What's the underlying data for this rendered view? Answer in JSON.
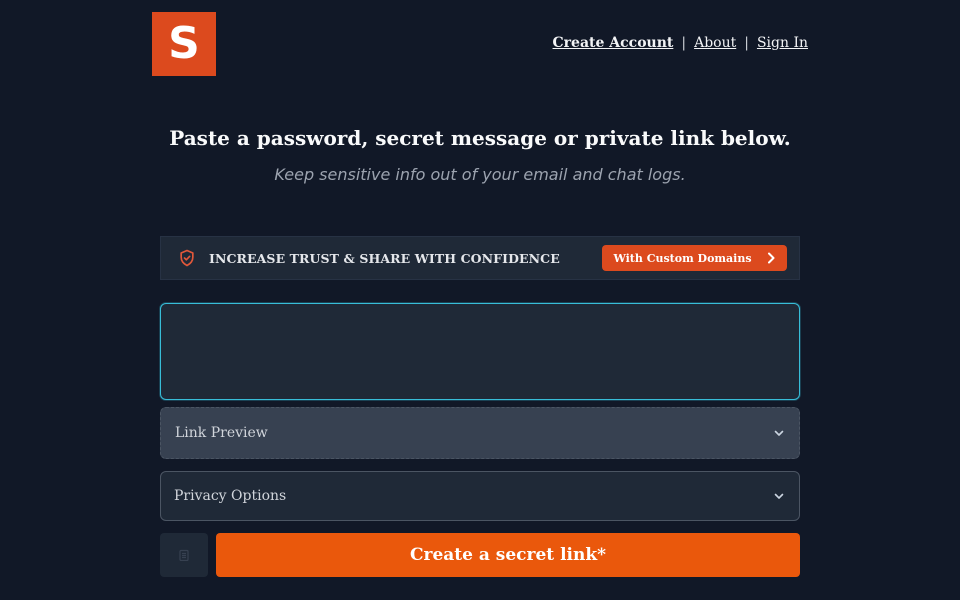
{
  "brand": {
    "logo_letter": "S",
    "accent": "#dc4a1e"
  },
  "nav": {
    "items": [
      {
        "label": "Create Account"
      },
      {
        "label": "About"
      },
      {
        "label": "Sign In"
      }
    ],
    "separator": "|"
  },
  "hero": {
    "title": "Paste a password, secret message or private link below.",
    "subtitle": "Keep sensitive info out of your email and chat logs."
  },
  "banner": {
    "icon": "shield-check-icon",
    "text": "INCREASE TRUST & SHARE WITH CONFIDENCE",
    "cta_label": "With Custom Domains",
    "cta_icon": "chevron-right-icon"
  },
  "form": {
    "secret": {
      "value": "",
      "placeholder": ""
    },
    "link_preview": {
      "label": "Link Preview",
      "icon": "chevron-down-icon"
    },
    "privacy_options": {
      "label": "Privacy Options",
      "icon": "chevron-down-icon"
    },
    "aux_button_icon": "clipboard-icon",
    "submit_label": "Create a secret link*"
  },
  "colors": {
    "background": "#111827",
    "panel": "#1f2937",
    "focus_ring": "#38bdd8",
    "submit": "#ea580c"
  }
}
